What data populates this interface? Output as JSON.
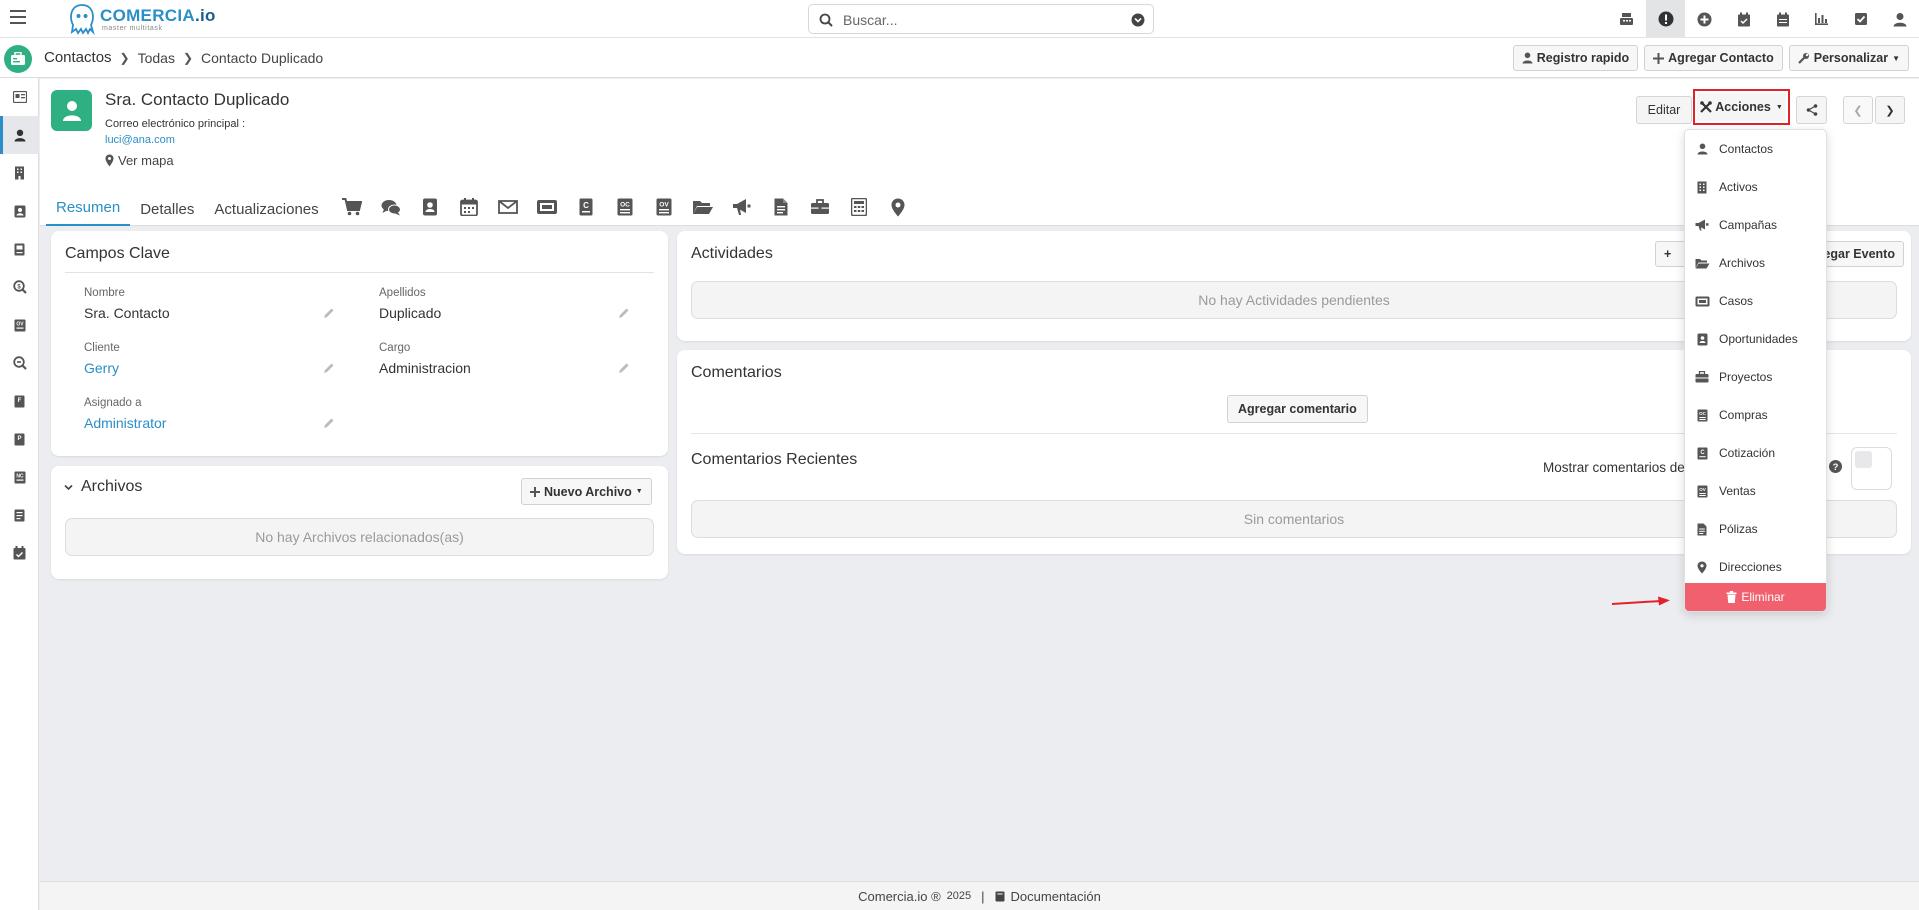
{
  "app": {
    "brand_name_a": "COMERCIA",
    "brand_name_b": ".io",
    "brand_tagline": "master multitask"
  },
  "search": {
    "placeholder": "Buscar..."
  },
  "breadcrumb": {
    "module": "Contactos",
    "list": "Todas",
    "record": "Contacto Duplicado"
  },
  "toolbar": {
    "quick_register": "Registro rapido",
    "add_contact": "Agregar Contacto",
    "customize": "Personalizar"
  },
  "record": {
    "name": "Sra. Contacto Duplicado",
    "email_label": "Correo electrónico principal :",
    "email": "luci@ana.com",
    "map_link": "Ver mapa",
    "edit_label": "Editar",
    "actions_label": "Acciones"
  },
  "tabs": [
    "Resumen",
    "Detalles",
    "Actualizaciones"
  ],
  "key_fields": {
    "title": "Campos Clave",
    "fields": [
      {
        "label": "Nombre",
        "value": "Sra. Contacto"
      },
      {
        "label": "Apellidos",
        "value": "Duplicado"
      },
      {
        "label": "Cliente",
        "value": "Gerry"
      },
      {
        "label": "Cargo",
        "value": "Administracion"
      },
      {
        "label": "Asignado a",
        "value": "Administrator"
      }
    ]
  },
  "files": {
    "title": "Archivos",
    "new_button": "Nuevo Archivo",
    "empty": "No hay Archivos relacionados(as)"
  },
  "activities": {
    "title": "Actividades",
    "add_event": "Agregar Evento",
    "add_partial": "+",
    "empty": "No hay Actividades pendientes"
  },
  "comments": {
    "title": "Comentarios",
    "add_button": "Agregar comentario",
    "recent_title": "Comentarios Recientes",
    "show_label": "Mostrar comentarios de",
    "empty": "Sin comentarios"
  },
  "actions_menu": {
    "items": [
      "Contactos",
      "Activos",
      "Campañas",
      "Archivos",
      "Casos",
      "Oportunidades",
      "Proyectos",
      "Compras",
      "Cotización",
      "Ventas",
      "Pólizas",
      "Direcciones"
    ],
    "delete": "Eliminar"
  },
  "footer": {
    "copyright": "Comercia.io ®",
    "year": "2025",
    "separator": "|",
    "docs": "Documentación"
  },
  "colors": {
    "brand_blue": "#2a8ec7",
    "brand_green": "#2fb082",
    "delete_red": "#f0606e",
    "highlight_red": "#e0232a"
  }
}
